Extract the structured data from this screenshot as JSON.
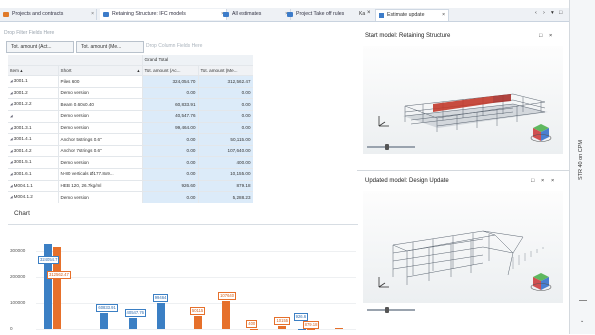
{
  "tabs": [
    {
      "label": "Projects and contracts",
      "color": "#e07b2b"
    },
    {
      "label": "Retaining Structure: IFC models",
      "color": "#3d7cc9"
    },
    {
      "label": "All estimates",
      "color": "#3d7cc9"
    },
    {
      "label": "Project Take off rules",
      "color": "#3d7cc9"
    }
  ],
  "close_glyph": "×",
  "filter_zone": "Drop Filter Fields Here",
  "column_zone": "Drop Column Fields Here",
  "field_buttons": [
    "Tot. amount (Act...",
    "Tot. amount (Me..."
  ],
  "grid": {
    "header_item": "Item",
    "header_short": "Short",
    "grand_total": "Grand Total",
    "col_a": "Tot. amount (Ac...",
    "col_b": "Tot. amount (Me...",
    "rows": [
      {
        "item": "3001.1",
        "short": "Piles 600",
        "a": "324,054.70",
        "b": "312,562.47"
      },
      {
        "item": "3001.2",
        "short": "Demo version",
        "a": "0.00",
        "b": "0.00"
      },
      {
        "item": "3001.2.2",
        "short": "Beam 0.60x0.40",
        "a": "60,833.91",
        "b": "0.00"
      },
      {
        "item": "",
        "short": "Demo version",
        "a": "40,547.76",
        "b": "0.00"
      },
      {
        "item": "3001.3.1",
        "short": "Demo version",
        "a": "99,464.00",
        "b": "0.00"
      },
      {
        "item": "3001.4.1",
        "short": "Anchor 5strings 0.6\"",
        "a": "0.00",
        "b": "50,115.00"
      },
      {
        "item": "3001.4.2",
        "short": "Anchor 7strings 0.6\"",
        "a": "0.00",
        "b": "107,640.00"
      },
      {
        "item": "3001.5.1",
        "short": "Demo version",
        "a": "0.00",
        "b": "400.00"
      },
      {
        "item": "3001.6.1",
        "short": "N-80 verticals Ø177.8x9...",
        "a": "0.00",
        "b": "10,155.00"
      },
      {
        "item": "M004.1.1",
        "short": "HEB 120, 26.7kg/ml",
        "a": "926.60",
        "b": "879.18"
      },
      {
        "item": "M004.1.2",
        "short": "Demo version",
        "a": "0.00",
        "b": "5,288.23"
      }
    ]
  },
  "chart": {
    "panel_label": "Chart",
    "colors": {
      "series_a": "#3b7fc4",
      "series_b": "#e6702b"
    }
  },
  "chart_data": {
    "type": "bar",
    "ylim": [
      0,
      360000
    ],
    "yticks": [
      0,
      100000,
      200000,
      300000
    ],
    "ytick_labels": [
      "0",
      "100000",
      "200000",
      "300000"
    ],
    "categories": [
      "3001.1",
      "3001.2",
      "3001.2.2",
      "",
      "3001.3.1",
      "3001.4.1",
      "3001.4.2",
      "3001.5.1",
      "3001.6.1",
      "M004.1.1",
      "M004.1.2"
    ],
    "series": [
      {
        "values": [
          324054.7,
          0,
          60833.91,
          40547.76,
          99464.0,
          0,
          0,
          0,
          0,
          926.6,
          0
        ]
      },
      {
        "values": [
          312562.47,
          0,
          0,
          0,
          0,
          50115.0,
          107640.0,
          400.0,
          10155.0,
          879.18,
          5288.23
        ]
      }
    ],
    "data_labels": [
      {
        "text": "324054.7",
        "cat": 0,
        "series": 0
      },
      {
        "text": "312562.47",
        "cat": 0,
        "series": 1
      },
      {
        "text": "60833.91",
        "cat": 2,
        "series": 0
      },
      {
        "text": "40547.76",
        "cat": 3,
        "series": 0
      },
      {
        "text": "99464",
        "cat": 4,
        "series": 0
      },
      {
        "text": "50115",
        "cat": 5,
        "series": 1
      },
      {
        "text": "107640",
        "cat": 6,
        "series": 1
      },
      {
        "text": "400",
        "cat": 7,
        "series": 1
      },
      {
        "text": "10155",
        "cat": 8,
        "series": 1
      },
      {
        "text": "926.6",
        "cat": 9,
        "series": 0
      },
      {
        "text": "879.18",
        "cat": 9,
        "series": 1
      }
    ]
  },
  "right_tab": {
    "prefix": "Ka",
    "label": "Estimate update",
    "controls": [
      "‹",
      "›",
      "▾",
      "□"
    ]
  },
  "start_model": {
    "title": "Start model: Retaining Structure",
    "buttons": [
      "□",
      "×"
    ]
  },
  "updated_model": {
    "title": "Updated model: Design Update",
    "buttons": [
      "□",
      "×",
      "×"
    ]
  },
  "side_strip_text": "STR 40 on CPM"
}
